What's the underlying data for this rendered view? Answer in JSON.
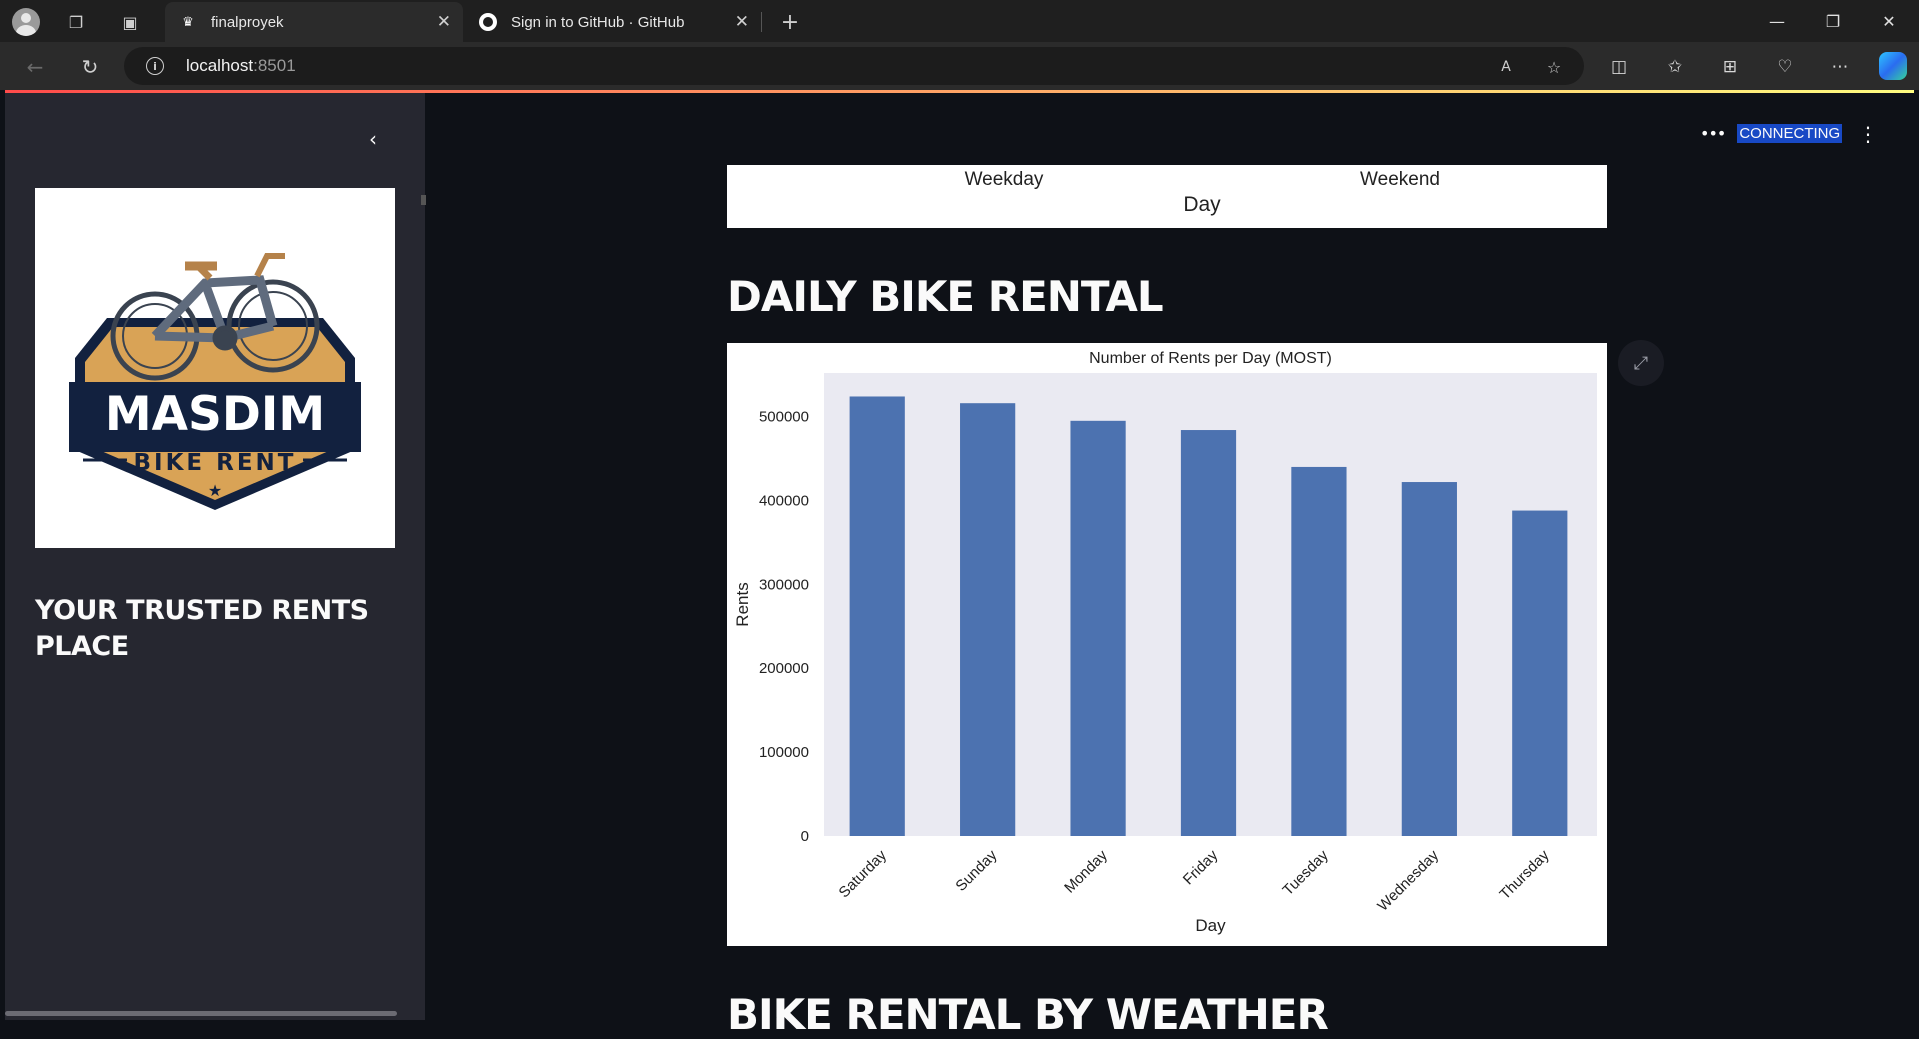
{
  "browser": {
    "tabs": [
      {
        "title": "finalproyek",
        "active": true
      },
      {
        "title": "Sign in to GitHub · GitHub",
        "active": false
      }
    ],
    "url_host": "localhost",
    "url_port": ":8501"
  },
  "sidebar": {
    "logo": {
      "line1": "MASDIM",
      "line2": "BIKE RENT"
    },
    "title": "YOUR TRUSTED RENTS PLACE"
  },
  "status": {
    "label": "CONNECTING"
  },
  "previous_chart": {
    "ticks": [
      "Weekday",
      "Weekend"
    ],
    "xlabel": "Day"
  },
  "sections": {
    "daily": "DAILY BIKE RENTAL",
    "weather": "BIKE RENTAL BY WEATHER"
  },
  "colors": {
    "bar": "#4c72b0",
    "plot_bg": "#eaeaf2",
    "app_bg": "#0e1117",
    "sidebar_bg": "#262730",
    "logo_gold": "#d9a356",
    "logo_navy": "#12213f"
  },
  "chart_data": {
    "type": "bar",
    "title": "Number of Rents per Day (MOST)",
    "xlabel": "Day",
    "ylabel": "Rents",
    "categories": [
      "Saturday",
      "Sunday",
      "Monday",
      "Friday",
      "Tuesday",
      "Wednesday",
      "Thursday"
    ],
    "values": [
      524000,
      516000,
      495000,
      484000,
      440000,
      422000,
      388000
    ],
    "ylim": [
      0,
      552000
    ],
    "yticks": [
      0,
      100000,
      200000,
      300000,
      400000,
      500000
    ],
    "grid": false,
    "legend": "none"
  }
}
